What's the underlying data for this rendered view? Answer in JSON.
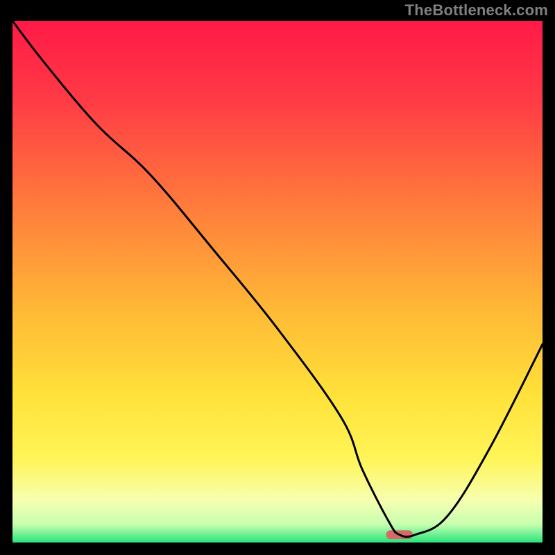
{
  "watermark": "TheBottleneck.com",
  "chart_data": {
    "type": "line",
    "title": "",
    "xlabel": "",
    "ylabel": "",
    "xlim": [
      0,
      100
    ],
    "ylim": [
      0,
      100
    ],
    "gradient_stops": [
      {
        "offset": 0.0,
        "color": "#ff1a47"
      },
      {
        "offset": 0.15,
        "color": "#ff3a45"
      },
      {
        "offset": 0.35,
        "color": "#ff7a3c"
      },
      {
        "offset": 0.55,
        "color": "#ffb836"
      },
      {
        "offset": 0.72,
        "color": "#ffe23a"
      },
      {
        "offset": 0.84,
        "color": "#fff558"
      },
      {
        "offset": 0.92,
        "color": "#f6ffb0"
      },
      {
        "offset": 0.965,
        "color": "#c8ffb0"
      },
      {
        "offset": 1.0,
        "color": "#28e57a"
      }
    ],
    "series": [
      {
        "name": "bottleneck-curve",
        "x": [
          0,
          6,
          16,
          26,
          38,
          50,
          62,
          66,
          71,
          73,
          76,
          82,
          90,
          100
        ],
        "values": [
          100,
          92,
          80,
          70.5,
          56,
          41,
          24,
          14,
          4,
          1.5,
          1.5,
          5,
          18,
          38
        ]
      }
    ],
    "marker": {
      "x": 73,
      "y": 1.5,
      "width_frac": 0.05,
      "height_frac": 0.017,
      "color": "#d46a6a",
      "rx": 6
    }
  }
}
